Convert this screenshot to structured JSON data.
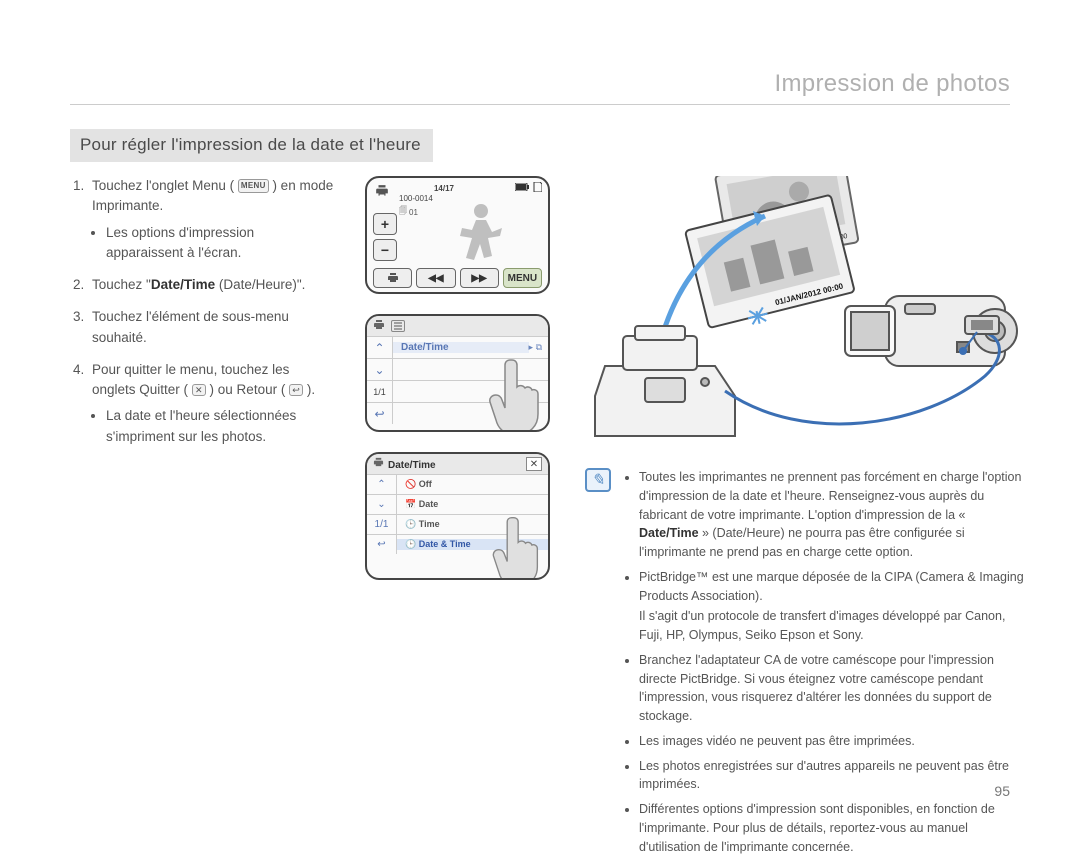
{
  "header": {
    "title": "Impression de photos"
  },
  "subtitle": "Pour régler l'impression de la date et l'heure",
  "menu_chip": "MENU",
  "steps": [
    {
      "pre": "Touchez l'onglet Menu ( ",
      "post": " ) en mode Imprimante.",
      "sub": [
        "Les options d'impression apparaissent à l'écran."
      ]
    },
    {
      "pre": "Touchez \"",
      "bold": "Date/Time",
      "post": " (Date/Heure)\"."
    },
    {
      "text": "Touchez l'élément de sous-menu souhaité."
    },
    {
      "pre": "Pour quitter le menu, touchez les onglets Quitter ( ",
      "icon1": "✕",
      "mid": " ) ou Retour ( ",
      "icon2": "↩",
      "post": " ).",
      "sub": [
        "La date et l'heure sélectionnées s'impriment sur les photos."
      ]
    }
  ],
  "screen1": {
    "counter": "14/17",
    "filecode": "100-0014",
    "folder": "01",
    "menu_label": "MENU"
  },
  "screen2": {
    "row_label": "Date/Time",
    "page": "1/1"
  },
  "screen3": {
    "title": "Date/Time",
    "options": [
      "Off",
      "Date",
      "Time",
      "Date & Time"
    ],
    "page": "1/1"
  },
  "photos": {
    "stamp1": "01/JAN/2012 00:00",
    "stamp2": "01/JAN/2012 00:00"
  },
  "notes": [
    {
      "text": "Toutes les imprimantes ne prennent pas forcément en charge l'option d'impression de la date et l'heure. Renseignez-vous auprès du fabricant de votre imprimante. L'option d'impression de la « ",
      "bold": "Date/Time",
      "tail": " » (Date/Heure) ne pourra pas être configurée si l'imprimante ne prend pas en charge cette option."
    },
    {
      "text": "PictBridge™ est une marque déposée de la CIPA (Camera & Imaging Products Association).",
      "cont": "Il s'agit d'un protocole de transfert d'images développé par Canon, Fuji, HP, Olympus, Seiko Epson et Sony."
    },
    {
      "text": "Branchez l'adaptateur CA de votre caméscope pour l'impression directe PictBridge. Si vous éteignez votre caméscope pendant l'impression, vous risquerez d'altérer les données du support de stockage."
    },
    {
      "text": "Les images vidéo ne peuvent pas être imprimées."
    },
    {
      "text": "Les photos enregistrées sur d'autres appareils ne peuvent pas être imprimées."
    },
    {
      "text": "Différentes options d'impression sont disponibles, en fonction de l'imprimante. Pour plus de détails, reportez-vous au manuel d'utilisation de l'imprimante concernée."
    }
  ],
  "page_number": "95"
}
